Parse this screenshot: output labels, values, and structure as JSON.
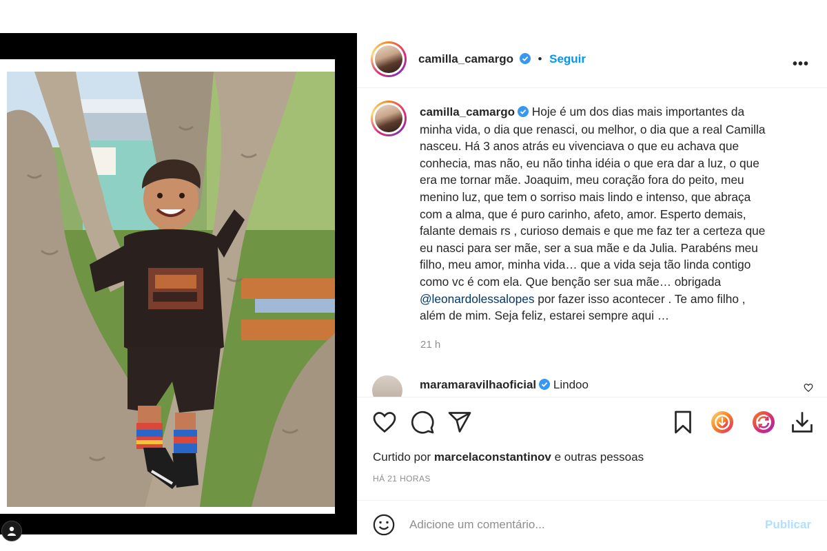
{
  "post": {
    "author": "camilla_camargo",
    "follow_label": "Seguir",
    "more_label": "•••",
    "caption_lines": [
      "Hoje é um dos dias mais importantes da",
      "minha vida, o dia que renasci, ou melhor, o dia que a real Camilla",
      "nasceu. Há 3 anos atrás eu vivenciava o que eu achava que",
      "conhecia, mas não, eu não tinha idéia o que era dar a luz, o que",
      "era me tornar mãe. Joaquim, meu coração fora do peito, meu",
      "menino luz, que tem o sorriso mais lindo e intenso, que abraça",
      "com a alma, que é puro carinho, afeto, amor. Esperto demais,",
      "falante demais rs , curioso demais e que me faz ter a certeza que",
      "eu nasci para ser mãe, ser a sua mãe e da Julia. Parabéns meu",
      "filho, meu amor, minha vida… que a vida seja tão linda contigo",
      "como vc é com ela. Que benção ser sua mãe… obrigada"
    ],
    "caption_mention": "@leonardolessalopes",
    "caption_after_mention": " por fazer isso acontecer . Te amo filho ,",
    "caption_last_line": "além de mim. Seja feliz, estarei sempre aqui …",
    "caption_time": "21 h"
  },
  "comment": {
    "user": "maramaravilhaoficial",
    "text": "Lindoo"
  },
  "actions": {
    "liked_prefix": "Curtido por ",
    "liked_user": "marcelaconstantinov",
    "liked_suffix": " e outras pessoas",
    "age": "HÁ 21 HORAS"
  },
  "comment_box": {
    "placeholder": "Adicione um comentário...",
    "publish_label": "Publicar"
  },
  "colors": {
    "link_blue": "#0095f6",
    "publish_disabled": "#b2dffc",
    "verified_blue": "#3897f0",
    "muted": "#8e8e8e"
  },
  "icons": {
    "like": "heart-icon",
    "comment": "speech-bubble-icon",
    "share": "paper-plane-icon",
    "save": "bookmark-icon",
    "download_orange": "download-circle-icon",
    "repost": "repost-circle-icon",
    "download": "download-tray-icon",
    "emoji": "emoji-icon",
    "user_tag": "user-tag-icon"
  }
}
